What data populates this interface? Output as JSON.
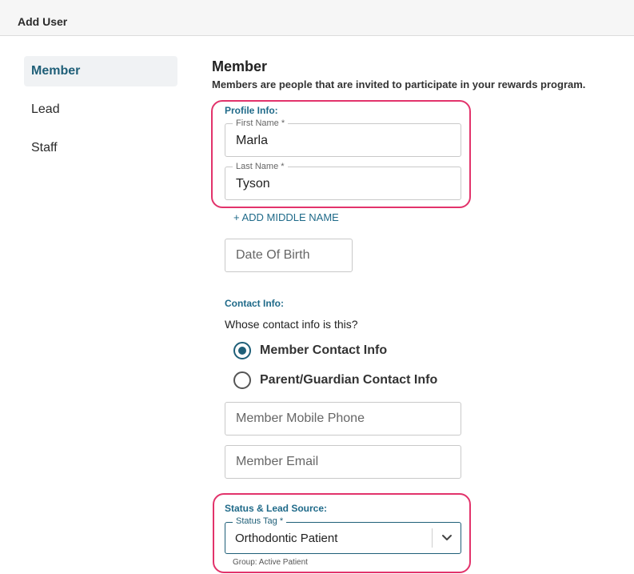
{
  "header": {
    "title": "Add User"
  },
  "nav": {
    "items": [
      {
        "label": "Member",
        "active": true
      },
      {
        "label": "Lead",
        "active": false
      },
      {
        "label": "Staff",
        "active": false
      }
    ]
  },
  "main": {
    "title": "Member",
    "description": "Members are people that are invited to participate in your rewards program."
  },
  "profile": {
    "section_label": "Profile Info:",
    "first_name": {
      "label": "First Name *",
      "value": "Marla"
    },
    "last_name": {
      "label": "Last Name *",
      "value": "Tyson"
    },
    "add_middle_name": "+ ADD MIDDLE NAME",
    "dob_placeholder": "Date Of Birth"
  },
  "contact": {
    "section_label": "Contact Info:",
    "question": "Whose contact info is this?",
    "options": [
      {
        "label": "Member Contact Info",
        "checked": true
      },
      {
        "label": "Parent/Guardian Contact Info",
        "checked": false
      }
    ],
    "phone_placeholder": "Member Mobile Phone",
    "email_placeholder": "Member Email"
  },
  "status": {
    "section_label": "Status & Lead Source:",
    "status_tag": {
      "label": "Status Tag *",
      "value": "Orthodontic Patient"
    },
    "helper": "Group: Active Patient"
  },
  "icons": {
    "select_arrow": "chevron-down-icon"
  },
  "colors": {
    "accent": "#1f5f78",
    "highlight": "#e2336b",
    "link": "#1f6a89"
  }
}
